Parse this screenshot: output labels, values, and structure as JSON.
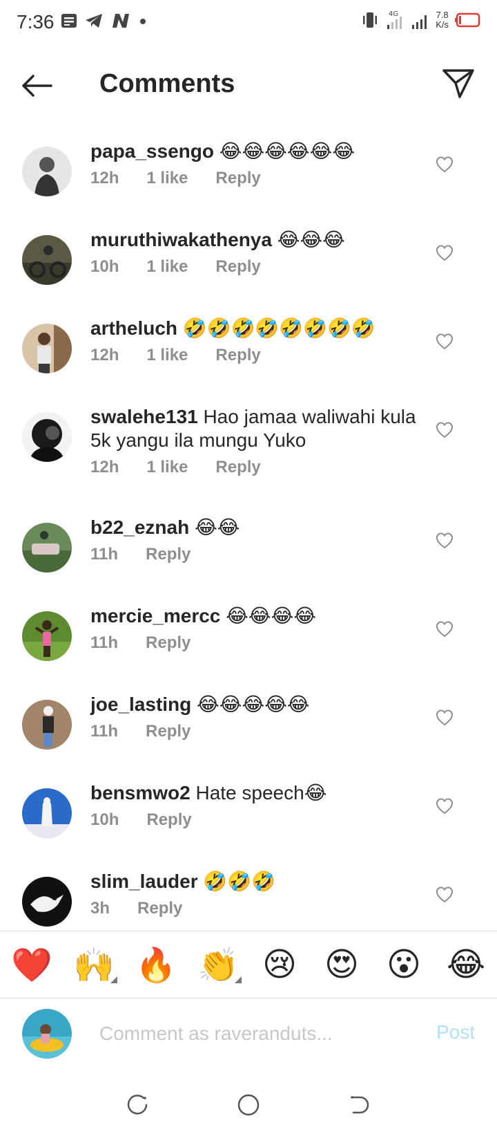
{
  "status_bar": {
    "time": "7:36",
    "network": "4G",
    "speed_value": "7.8",
    "speed_unit": "K/s"
  },
  "header": {
    "title": "Comments"
  },
  "comments": [
    {
      "username": "papa_ssengo",
      "text": "😂😂😂😂😂😂",
      "time": "12h",
      "likes": "1 like",
      "reply": "Reply"
    },
    {
      "username": "muruthiwakathenya",
      "text": "😂😂😂",
      "time": "10h",
      "likes": "1 like",
      "reply": "Reply"
    },
    {
      "username": "artheluch",
      "text": "🤣🤣🤣🤣🤣🤣🤣🤣",
      "time": "12h",
      "likes": "1 like",
      "reply": "Reply"
    },
    {
      "username": "swalehe131",
      "text": "Hao jamaa waliwahi kula 5k yangu ila mungu Yuko",
      "time": "12h",
      "likes": "1 like",
      "reply": "Reply"
    },
    {
      "username": "b22_eznah",
      "text": "😂😂",
      "time": "11h",
      "likes": "",
      "reply": "Reply"
    },
    {
      "username": "mercie_mercc",
      "text": "😂😂😂😂",
      "time": "11h",
      "likes": "",
      "reply": "Reply"
    },
    {
      "username": "joe_lasting",
      "text": "😂😂😂😂😂",
      "time": "11h",
      "likes": "",
      "reply": "Reply"
    },
    {
      "username": "bensmwo2",
      "text": "Hate speech😂",
      "time": "10h",
      "likes": "",
      "reply": "Reply"
    },
    {
      "username": "slim_lauder",
      "text": "🤣🤣🤣",
      "time": "3h",
      "likes": "",
      "reply": "Reply"
    }
  ],
  "emoji_bar": [
    "❤️",
    "🙌",
    "🔥",
    "👏",
    "😢",
    "😍",
    "😮",
    "😂"
  ],
  "composer": {
    "placeholder": "Comment as raveranduts...",
    "post_label": "Post"
  }
}
